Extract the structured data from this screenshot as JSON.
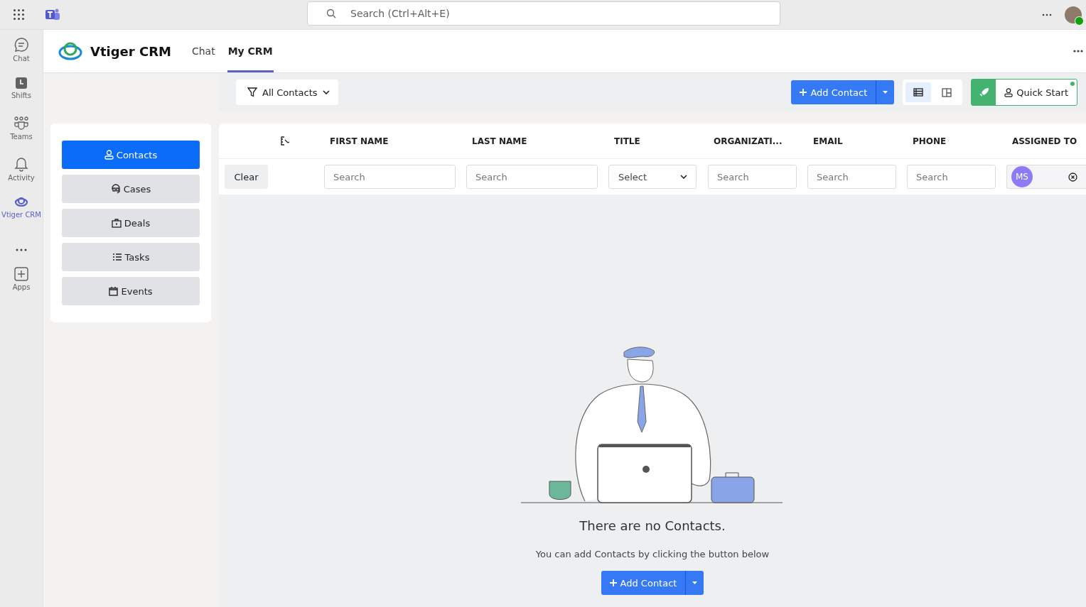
{
  "top_bar": {
    "search": {
      "placeholder": "Search (Ctrl+Alt+E)"
    }
  },
  "rail": [
    {
      "label": "Chat",
      "kind": "chat",
      "selected": false
    },
    {
      "label": "Shifts",
      "kind": "shifts",
      "selected": false
    },
    {
      "label": "Teams",
      "kind": "teams",
      "selected": false
    },
    {
      "label": "Activity",
      "kind": "activity",
      "selected": false
    },
    {
      "label": "Vtiger CRM",
      "kind": "app",
      "selected": true
    },
    {
      "label": "Apps",
      "kind": "apps",
      "selected": false
    }
  ],
  "app_header": {
    "title": "Vtiger CRM",
    "tabs": [
      {
        "label": "Chat",
        "selected": false
      },
      {
        "label": "My CRM",
        "selected": true
      }
    ]
  },
  "toolbar": {
    "filter": "All Contacts",
    "add_button": "Add Contact",
    "views": [
      {
        "kind": "list",
        "selected": true
      },
      {
        "kind": "kanban",
        "selected": false
      }
    ],
    "quick_start": "Quick Start"
  },
  "modules": [
    {
      "label": "Contacts",
      "kind": "contacts",
      "selected": true
    },
    {
      "label": "Cases",
      "kind": "cases",
      "selected": false
    },
    {
      "label": "Deals",
      "kind": "deals",
      "selected": false
    },
    {
      "label": "Tasks",
      "kind": "tasks",
      "selected": false
    },
    {
      "label": "Events",
      "kind": "events",
      "selected": false
    }
  ],
  "table": {
    "columns": [
      "FIRST NAME",
      "LAST NAME",
      "TITLE",
      "ORGANIZATI...",
      "EMAIL",
      "PHONE",
      "ASSIGNED TO"
    ],
    "clear": "Clear",
    "filters": [
      {
        "kind": "search",
        "placeholder": "Search"
      },
      {
        "kind": "search",
        "placeholder": "Search"
      },
      {
        "kind": "select",
        "value": "Select"
      },
      {
        "kind": "search",
        "placeholder": "Search"
      },
      {
        "kind": "search",
        "placeholder": "Search"
      },
      {
        "kind": "search",
        "placeholder": "Search"
      },
      {
        "kind": "user",
        "value": "MS"
      }
    ]
  },
  "empty": {
    "title": "There are no Contacts.",
    "subtitle": "You can add Contacts by clicking the button below",
    "button": "Add Contact"
  }
}
